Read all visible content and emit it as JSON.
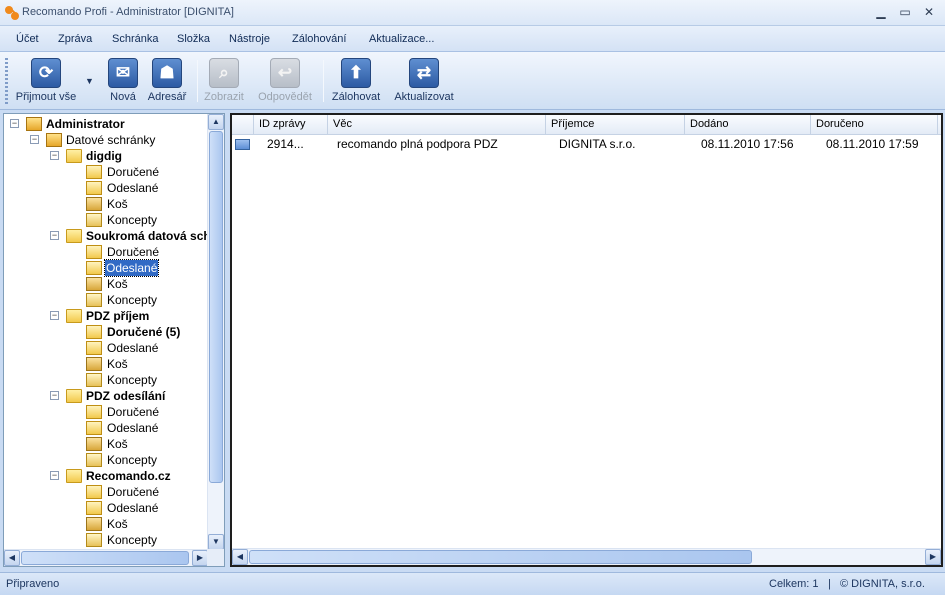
{
  "window": {
    "title": "Recomando Profi - Administrator [DIGNITA]",
    "minimize_glyph": "▁",
    "maximize_glyph": "▭",
    "close_glyph": "✕"
  },
  "menu": [
    "Účet",
    "Zpráva",
    "Schránka",
    "Složka",
    "Nástroje",
    "Zálohování",
    "Aktualizace..."
  ],
  "toolbar": {
    "buttons": [
      {
        "label": "Přijmout vše",
        "icon": "refresh-icon",
        "enabled": true
      },
      {
        "label": "Nová",
        "icon": "new-message-icon",
        "enabled": true
      },
      {
        "label": "Adresář",
        "icon": "address-book-icon",
        "enabled": true
      },
      {
        "label": "Zobrazit",
        "icon": "view-message-icon",
        "enabled": false
      },
      {
        "label": "Odpovědět",
        "icon": "reply-icon",
        "enabled": false
      },
      {
        "label": "Zálohovat",
        "icon": "backup-icon",
        "enabled": true
      },
      {
        "label": "Aktualizovat",
        "icon": "update-icon",
        "enabled": true
      }
    ]
  },
  "tree": {
    "root": "Administrator",
    "datove_schranky": "Datové schránky",
    "boxes": [
      {
        "name": "digdig",
        "folders": [
          "Doručené",
          "Odeslané",
          "Koš",
          "Koncepty"
        ]
      },
      {
        "name": "Soukromá datová sch",
        "folders": [
          "Doručené",
          "Odeslané",
          "Koš",
          "Koncepty"
        ]
      },
      {
        "name": "PDZ příjem",
        "folders": [
          "Doručené (5)",
          "Odeslané",
          "Koš",
          "Koncepty"
        ]
      },
      {
        "name": "PDZ odesílání",
        "folders": [
          "Doručené",
          "Odeslané",
          "Koš",
          "Koncepty"
        ]
      },
      {
        "name": "Recomando.cz",
        "folders": [
          "Doručené",
          "Odeslané",
          "Koš",
          "Koncepty"
        ]
      }
    ],
    "selected": "Soukromá datová sch / Odeslané"
  },
  "list": {
    "columns": [
      "ID zprávy",
      "Věc",
      "Příjemce",
      "Dodáno",
      "Doručeno"
    ],
    "rows": [
      {
        "id": "2914...",
        "subject": "recomando plná podpora PDZ",
        "recipient": "DIGNITA s.r.o.",
        "delivered": "08.11.2010 17:56",
        "received": "08.11.2010 17:59"
      }
    ]
  },
  "status": {
    "left": "Připraveno",
    "count": "Celkem:  1",
    "separator": "|",
    "copyright": "© DIGNITA, s.r.o."
  }
}
